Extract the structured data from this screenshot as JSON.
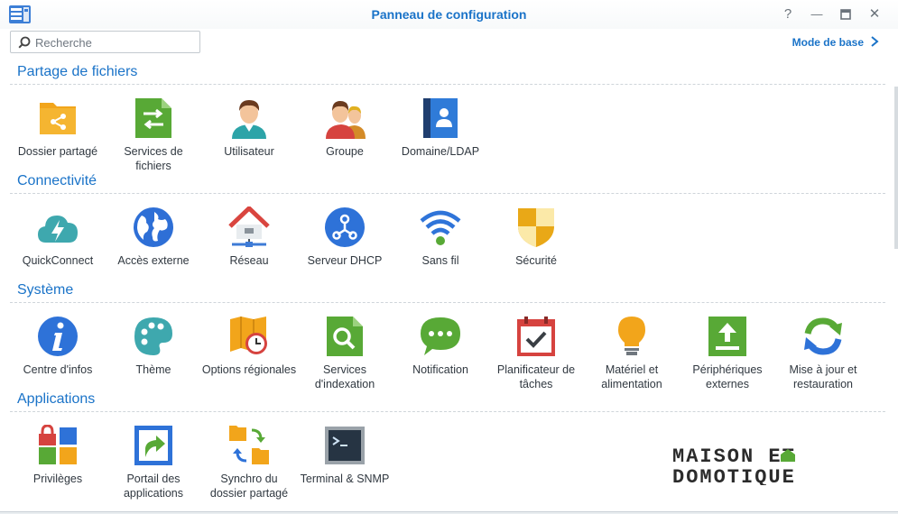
{
  "window": {
    "title": "Panneau de configuration",
    "help_symbol": "?",
    "min_symbol": "—",
    "max_symbol": "□",
    "close_symbol": "✕"
  },
  "search": {
    "placeholder": "Recherche"
  },
  "mode_link": "Mode de base",
  "sections": [
    {
      "title": "Partage de fichiers",
      "items": [
        {
          "label": "Dossier partagé",
          "icon": "shared-folder-icon"
        },
        {
          "label": "Services de fichiers",
          "icon": "file-services-icon"
        },
        {
          "label": "Utilisateur",
          "icon": "user-icon"
        },
        {
          "label": "Groupe",
          "icon": "group-icon"
        },
        {
          "label": "Domaine/LDAP",
          "icon": "domain-ldap-icon"
        }
      ]
    },
    {
      "title": "Connectivité",
      "items": [
        {
          "label": "QuickConnect",
          "icon": "quickconnect-icon"
        },
        {
          "label": "Accès externe",
          "icon": "globe-icon"
        },
        {
          "label": "Réseau",
          "icon": "network-house-icon"
        },
        {
          "label": "Serveur DHCP",
          "icon": "dhcp-icon"
        },
        {
          "label": "Sans fil",
          "icon": "wifi-icon"
        },
        {
          "label": "Sécurité",
          "icon": "shield-icon"
        }
      ]
    },
    {
      "title": "Système",
      "items": [
        {
          "label": "Centre d'infos",
          "icon": "info-icon"
        },
        {
          "label": "Thème",
          "icon": "palette-icon"
        },
        {
          "label": "Options régionales",
          "icon": "regional-clock-icon"
        },
        {
          "label": "Services d'indexation",
          "icon": "indexing-search-icon"
        },
        {
          "label": "Notification",
          "icon": "chat-bubble-icon"
        },
        {
          "label": "Planificateur de tâches",
          "icon": "calendar-check-icon"
        },
        {
          "label": "Matériel et alimentation",
          "icon": "lightbulb-icon"
        },
        {
          "label": "Périphériques externes",
          "icon": "external-device-icon"
        },
        {
          "label": "Mise à jour et restauration",
          "icon": "refresh-icon"
        }
      ]
    },
    {
      "title": "Applications",
      "items": [
        {
          "label": "Privilèges",
          "icon": "privileges-lock-icon"
        },
        {
          "label": "Portail des applications",
          "icon": "app-portal-icon"
        },
        {
          "label": "Synchro du dossier partagé",
          "icon": "sync-folders-icon"
        },
        {
          "label": "Terminal & SNMP",
          "icon": "terminal-icon"
        }
      ]
    }
  ],
  "logo": {
    "line1": "MAISON ET",
    "line2": "DOMOTIQUE"
  },
  "colors": {
    "accent": "#1a73c8"
  }
}
